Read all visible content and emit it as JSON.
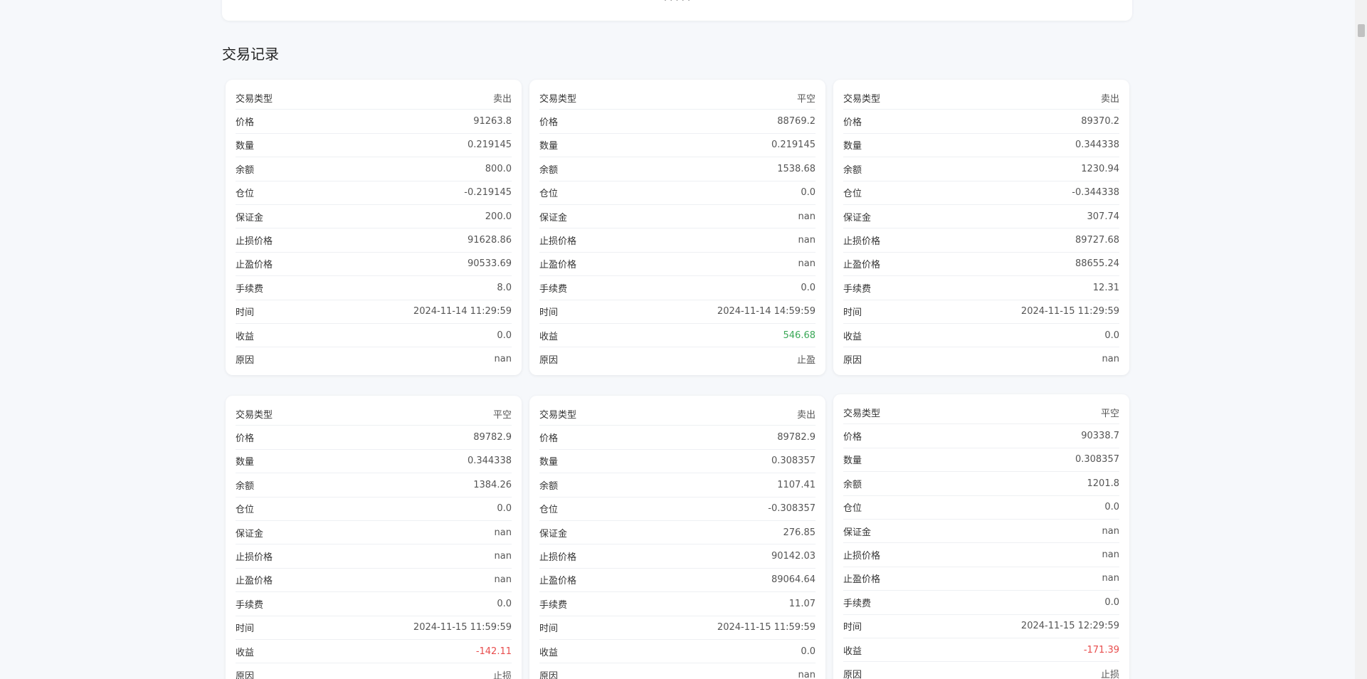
{
  "top_panel": {
    "clipped_text": "· · · · ·"
  },
  "section_title": "交易记录",
  "labels": {
    "type": "交易类型",
    "price": "价格",
    "qty": "数量",
    "balance": "余额",
    "position": "仓位",
    "margin": "保证金",
    "stop_loss": "止损价格",
    "take_profit": "止盈价格",
    "fee": "手续费",
    "time": "时间",
    "pnl": "收益",
    "reason": "原因"
  },
  "trades": [
    {
      "type": "卖出",
      "price": "91263.8",
      "qty": "0.219145",
      "balance": "800.0",
      "position": "-0.219145",
      "margin": "200.0",
      "stop_loss": "91628.86",
      "take_profit": "90533.69",
      "fee": "8.0",
      "time": "2024-11-14 11:29:59",
      "pnl": "0.0",
      "pnl_sign": "neutral",
      "reason": "nan"
    },
    {
      "type": "平空",
      "price": "88769.2",
      "qty": "0.219145",
      "balance": "1538.68",
      "position": "0.0",
      "margin": "nan",
      "stop_loss": "nan",
      "take_profit": "nan",
      "fee": "0.0",
      "time": "2024-11-14 14:59:59",
      "pnl": "546.68",
      "pnl_sign": "profit",
      "reason": "止盈"
    },
    {
      "type": "卖出",
      "price": "89370.2",
      "qty": "0.344338",
      "balance": "1230.94",
      "position": "-0.344338",
      "margin": "307.74",
      "stop_loss": "89727.68",
      "take_profit": "88655.24",
      "fee": "12.31",
      "time": "2024-11-15 11:29:59",
      "pnl": "0.0",
      "pnl_sign": "neutral",
      "reason": "nan"
    },
    {
      "type": "平空",
      "price": "89782.9",
      "qty": "0.344338",
      "balance": "1384.26",
      "position": "0.0",
      "margin": "nan",
      "stop_loss": "nan",
      "take_profit": "nan",
      "fee": "0.0",
      "time": "2024-11-15 11:59:59",
      "pnl": "-142.11",
      "pnl_sign": "loss",
      "reason": "止损"
    },
    {
      "type": "卖出",
      "price": "89782.9",
      "qty": "0.308357",
      "balance": "1107.41",
      "position": "-0.308357",
      "margin": "276.85",
      "stop_loss": "90142.03",
      "take_profit": "89064.64",
      "fee": "11.07",
      "time": "2024-11-15 11:59:59",
      "pnl": "0.0",
      "pnl_sign": "neutral",
      "reason": "nan"
    },
    {
      "type": "平空",
      "price": "90338.7",
      "qty": "0.308357",
      "balance": "1201.8",
      "position": "0.0",
      "margin": "nan",
      "stop_loss": "nan",
      "take_profit": "nan",
      "fee": "0.0",
      "time": "2024-11-15 12:29:59",
      "pnl": "-171.39",
      "pnl_sign": "loss",
      "reason": "止损"
    }
  ],
  "colors": {
    "profit": "#3aa857",
    "loss": "#e84d4d",
    "background": "#f6f8fb"
  }
}
